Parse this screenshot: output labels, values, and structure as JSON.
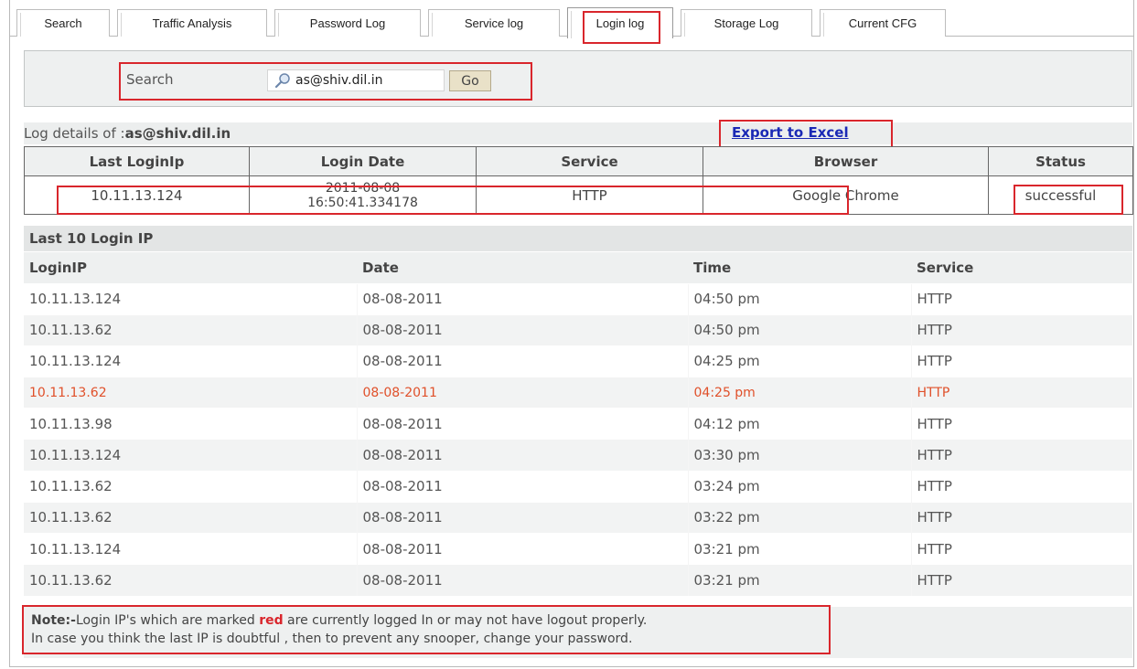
{
  "tabs": [
    {
      "label": "Search"
    },
    {
      "label": "Traffic Analysis"
    },
    {
      "label": "Password Log"
    },
    {
      "label": "Service log"
    },
    {
      "label": "Login log"
    },
    {
      "label": "Storage Log"
    },
    {
      "label": "Current CFG"
    }
  ],
  "search": {
    "label": "Search",
    "value": "as@shiv.dil.in",
    "go_label": "Go"
  },
  "log_details": {
    "prefix": "Log details of :",
    "user": "as@shiv.dil.in",
    "export_label": "Export to Excel"
  },
  "summary": {
    "headers": [
      "Last LoginIp",
      "Login Date",
      "Service",
      "Browser",
      "Status"
    ],
    "row": {
      "ip": "10.11.13.124",
      "date_line1": "2011-08-08",
      "date_line2": "16:50:41.334178",
      "service": "HTTP",
      "browser": "Google Chrome",
      "status": "successful"
    }
  },
  "last_logins": {
    "heading": "Last 10 Login IP",
    "headers": [
      "LoginIP",
      "Date",
      "Time",
      "Service"
    ],
    "rows": [
      {
        "ip": "10.11.13.124",
        "date": "08-08-2011",
        "time": "04:50 pm",
        "service": "HTTP"
      },
      {
        "ip": "10.11.13.62",
        "date": "08-08-2011",
        "time": "04:50 pm",
        "service": "HTTP"
      },
      {
        "ip": "10.11.13.124",
        "date": "08-08-2011",
        "time": "04:25 pm",
        "service": "HTTP"
      },
      {
        "ip": "10.11.13.62",
        "date": "08-08-2011",
        "time": "04:25 pm",
        "service": "HTTP"
      },
      {
        "ip": "10.11.13.98",
        "date": "08-08-2011",
        "time": "04:12 pm",
        "service": "HTTP"
      },
      {
        "ip": "10.11.13.124",
        "date": "08-08-2011",
        "time": "03:30 pm",
        "service": "HTTP"
      },
      {
        "ip": "10.11.13.62",
        "date": "08-08-2011",
        "time": "03:24 pm",
        "service": "HTTP"
      },
      {
        "ip": "10.11.13.62",
        "date": "08-08-2011",
        "time": "03:22 pm",
        "service": "HTTP"
      },
      {
        "ip": "10.11.13.124",
        "date": "08-08-2011",
        "time": "03:21 pm",
        "service": "HTTP"
      },
      {
        "ip": "10.11.13.62",
        "date": "08-08-2011",
        "time": "03:21 pm",
        "service": "HTTP"
      }
    ]
  },
  "note": {
    "label": "Note:-",
    "text_before": "Login IP's which are marked ",
    "red_word": "red",
    "text_after": " are currently logged In or may not have logout properly.",
    "line2": "In case you think the last IP is doubtful , then to prevent any snooper, change your password."
  },
  "colors": {
    "highlight_red": "#d9262c",
    "logged_in_row": "#e0502a",
    "link_blue": "#1a29b5"
  }
}
